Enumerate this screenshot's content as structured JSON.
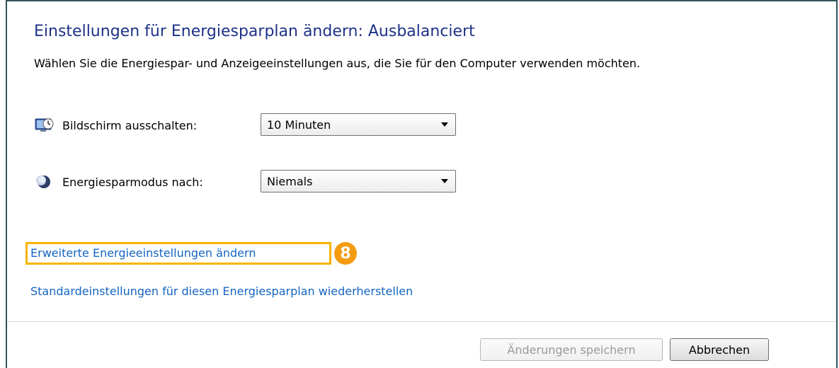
{
  "header": {
    "title": "Einstellungen für Energiesparplan ändern: Ausbalanciert",
    "subtitle": "Wählen Sie die Energiespar- und Anzeigeeinstellungen aus, die Sie für den Computer verwenden möchten."
  },
  "settings": {
    "display_off": {
      "label": "Bildschirm ausschalten:",
      "value": "10 Minuten",
      "icon": "monitor-clock-icon"
    },
    "sleep": {
      "label": "Energiesparmodus nach:",
      "value": "Niemals",
      "icon": "moon-icon"
    }
  },
  "links": {
    "advanced": "Erweiterte Energieeinstellungen ändern",
    "restore_defaults": "Standardeinstellungen für diesen Energiesparplan wiederherstellen"
  },
  "annotation": {
    "badge": "8",
    "color": "#f39c12",
    "box_color": "#f7b500"
  },
  "buttons": {
    "save": "Änderungen speichern",
    "cancel": "Abbrechen"
  }
}
